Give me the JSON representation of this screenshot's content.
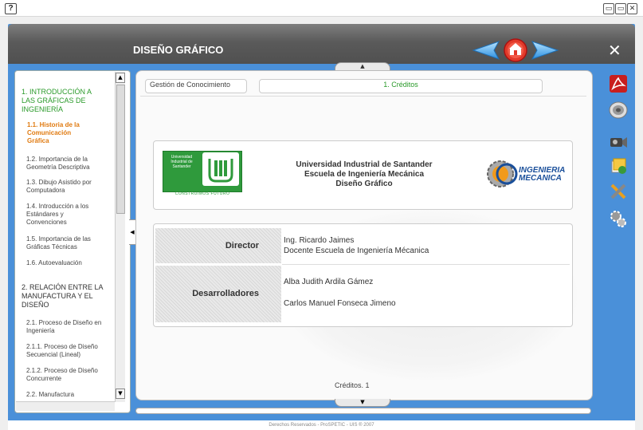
{
  "window": {
    "help_label": "?",
    "controls": [
      "▭",
      "▭",
      "✕"
    ]
  },
  "header": {
    "title": "DISEÑO GRÁFICO",
    "close_label": "✕",
    "nav_icons": [
      "arrow-left-icon",
      "home-icon",
      "arrow-right-icon"
    ],
    "colors": {
      "header": "#5f5f5f",
      "frame": "#4a90d9",
      "accent_green": "#2a9a2a",
      "active_orange": "#e07a10"
    }
  },
  "sidebar": {
    "items": [
      {
        "label": "1. INTRODUCCIÓN A\nLAS GRÁFICAS DE\nINGENIERÍA",
        "kind": "chapter"
      },
      {
        "label": "1.1. Historia de la\nComunicación\nGráfica",
        "kind": "active"
      },
      {
        "label": "1.2. Importancia de la\nGeometría Descriptiva",
        "kind": "item"
      },
      {
        "label": "1.3. Dibujo Asistido por\nComputadora",
        "kind": "item"
      },
      {
        "label": "1.4. Introducción a los\nEstándares y\nConvenciones",
        "kind": "item"
      },
      {
        "label": "1.5. Importancia de las\nGráficas Técnicas",
        "kind": "item"
      },
      {
        "label": "1.6. Autoevaluación",
        "kind": "item"
      },
      {
        "label": "2. RELACIÓN ENTRE LA\nMANUFACTURA Y EL\nDISEÑO",
        "kind": "chapter"
      },
      {
        "label": "2.1. Proceso de Diseño en\nIngeniería",
        "kind": "item"
      },
      {
        "label": "2.1.1. Proceso de Diseño\nSecuencial (Lineal)",
        "kind": "sub"
      },
      {
        "label": "2.1.2. Proceso de Diseño\nConcurrente",
        "kind": "sub"
      },
      {
        "label": "2.2. Manufactura",
        "kind": "item"
      }
    ]
  },
  "content": {
    "breadcrumb": "Gestión de Conocimiento",
    "section_title": "1. Créditos",
    "institution": {
      "logo_text": "Universidad\nIndustrial de\nSantander",
      "slogan": "CONSTRUIMOS FUTURO",
      "lines": [
        "Universidad Industrial de Santander",
        "Escuela de Ingeniería Mecánica",
        "Diseño Gráfico"
      ],
      "dept_logo_text": "INGENIERIA\nMECANICA"
    },
    "credits": [
      {
        "role": "Director",
        "people": [
          "Ing. Ricardo Jaimes",
          "Docente Escuela de Ingeniería Mécanica"
        ]
      },
      {
        "role": "Desarrolladores",
        "people": [
          "Alba Judith Ardila Gámez",
          "Carlos Manuel Fonseca Jimeno"
        ]
      }
    ],
    "page_label": "Créditos. 1"
  },
  "toolbar": {
    "tools": [
      "pdf-icon",
      "audio-icon",
      "video-camera-icon",
      "gallery-icon",
      "tools-icon",
      "settings-gears-icon"
    ]
  },
  "footer": {
    "text": "Derechos Reservados - ProSPETIC - UIS ® 2007"
  }
}
